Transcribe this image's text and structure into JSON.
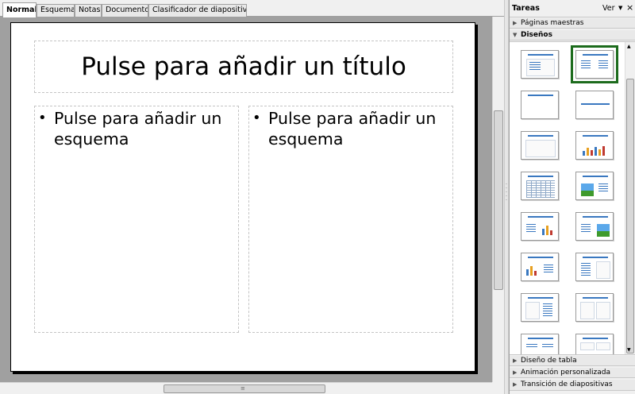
{
  "tabs": [
    "Normal",
    "Esquema",
    "Notas",
    "Documento",
    "Clasificador de diapositivas"
  ],
  "active_tab": "Normal",
  "slide": {
    "title_placeholder": "Pulse para añadir un título",
    "left_outline": "Pulse para añadir un esquema",
    "right_outline": "Pulse para añadir un esquema",
    "bullet": "•"
  },
  "scrollbars": {
    "grip": "≡"
  },
  "task_pane": {
    "title": "Tareas",
    "view_label": "Ver",
    "view_arrow": "▼",
    "close": "×",
    "sections": {
      "master_pages": "Páginas maestras",
      "layouts": "Diseños",
      "table_design": "Diseño de tabla",
      "custom_animation": "Animación personalizada",
      "slide_transition": "Transición de diapositivas"
    },
    "collapsed_arrow": "▶",
    "expanded_arrow": "▼",
    "selected_layout_index": 1,
    "layouts": [
      "title-content",
      "title-2-content",
      "title-only",
      "centered-text",
      "title-content-box",
      "title-chart",
      "title-table",
      "title-clipart-text",
      "title-text-chart",
      "title-text-clipart",
      "title-chart-text",
      "title-text-2col",
      "title-2col-text",
      "title-text-obj",
      "title-4-objects",
      "title-6-objects"
    ],
    "accent_color": "#3a78c0",
    "selection_color": "#1c6b1c"
  }
}
